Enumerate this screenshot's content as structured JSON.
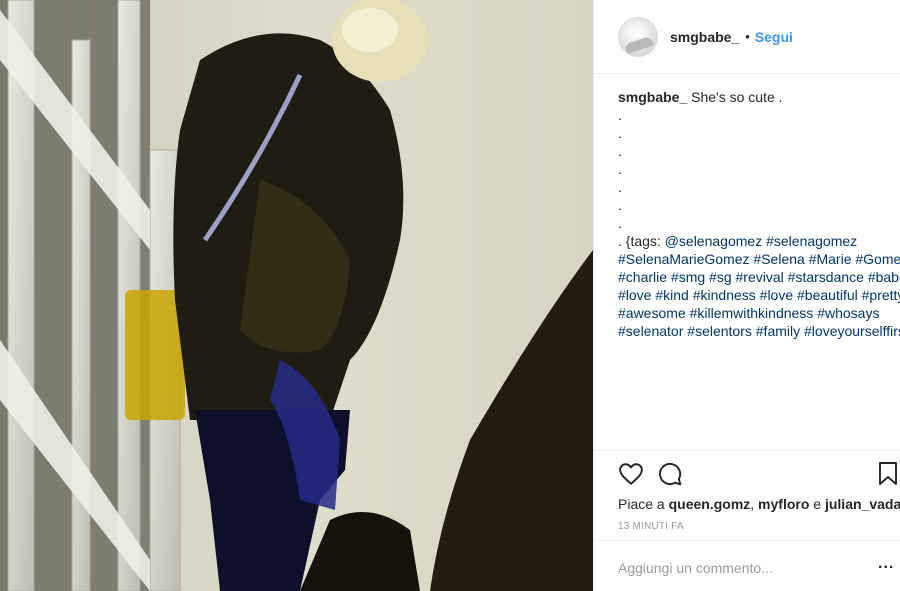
{
  "post": {
    "username": "smgbabe_",
    "separator": "•",
    "follow_label": "Segui",
    "caption": {
      "username": "smgbabe_",
      "text": "She's so cute .",
      "dots": [
        ".",
        ".",
        ".",
        ".",
        ".",
        ".",
        "."
      ],
      "tags_line": [
        {
          "t": ". {tags: ",
          "tag": false
        },
        {
          "t": "@selenagomez",
          "tag": true
        },
        {
          "t": " ",
          "tag": false
        },
        {
          "t": "#selenagomez",
          "tag": true
        },
        {
          "t": " ",
          "tag": false
        },
        {
          "t": "#SelenaMarieGomez",
          "tag": true
        },
        {
          "t": " ",
          "tag": false
        },
        {
          "t": "#Selena",
          "tag": true
        },
        {
          "t": " ",
          "tag": false
        },
        {
          "t": "#Marie",
          "tag": true
        },
        {
          "t": " ",
          "tag": false
        },
        {
          "t": "#Gomez",
          "tag": true
        },
        {
          "t": " ",
          "tag": false
        },
        {
          "t": "#charlie",
          "tag": true
        },
        {
          "t": " ",
          "tag": false
        },
        {
          "t": "#smg",
          "tag": true
        },
        {
          "t": " ",
          "tag": false
        },
        {
          "t": "#sg",
          "tag": true
        },
        {
          "t": " ",
          "tag": false
        },
        {
          "t": "#revival",
          "tag": true
        },
        {
          "t": " ",
          "tag": false
        },
        {
          "t": "#starsdance",
          "tag": true
        },
        {
          "t": " ",
          "tag": false
        },
        {
          "t": "#babe",
          "tag": true
        },
        {
          "t": " ",
          "tag": false
        },
        {
          "t": "#love",
          "tag": true
        },
        {
          "t": " ",
          "tag": false
        },
        {
          "t": "#kind",
          "tag": true
        },
        {
          "t": " ",
          "tag": false
        },
        {
          "t": "#kindness",
          "tag": true
        },
        {
          "t": " ",
          "tag": false
        },
        {
          "t": "#love",
          "tag": true
        },
        {
          "t": " ",
          "tag": false
        },
        {
          "t": "#beautiful",
          "tag": true
        },
        {
          "t": " ",
          "tag": false
        },
        {
          "t": "#pretty",
          "tag": true
        },
        {
          "t": " ",
          "tag": false
        },
        {
          "t": "#awesome",
          "tag": true
        },
        {
          "t": " ",
          "tag": false
        },
        {
          "t": "#killemwithkindness",
          "tag": true
        },
        {
          "t": " ",
          "tag": false
        },
        {
          "t": "#whosays",
          "tag": true
        },
        {
          "t": " ",
          "tag": false
        },
        {
          "t": "#selenator",
          "tag": true
        },
        {
          "t": " ",
          "tag": false
        },
        {
          "t": "#selentors",
          "tag": true
        },
        {
          "t": " ",
          "tag": false
        },
        {
          "t": "#family",
          "tag": true
        },
        {
          "t": " ",
          "tag": false
        },
        {
          "t": "#loveyourselffirst",
          "tag": true
        },
        {
          "t": "}",
          "tag": false
        }
      ]
    },
    "actions": {
      "like_icon": "heart-icon",
      "comment_icon": "comment-icon",
      "save_icon": "bookmark-icon"
    },
    "likes": {
      "prefix": "Piace a ",
      "user1": "queen.gomz",
      "sep1": ", ",
      "user2": "myfloro",
      "sep2": " e ",
      "user3": "julian_vada"
    },
    "timestamp": "13 MINUTI FA",
    "comment": {
      "placeholder": "Aggiungi un commento...",
      "more_label": "..."
    }
  },
  "colors": {
    "link_blue": "#3897f0",
    "hashtag": "#003569",
    "text": "#262626",
    "muted": "#999999",
    "divider": "#efefef"
  }
}
